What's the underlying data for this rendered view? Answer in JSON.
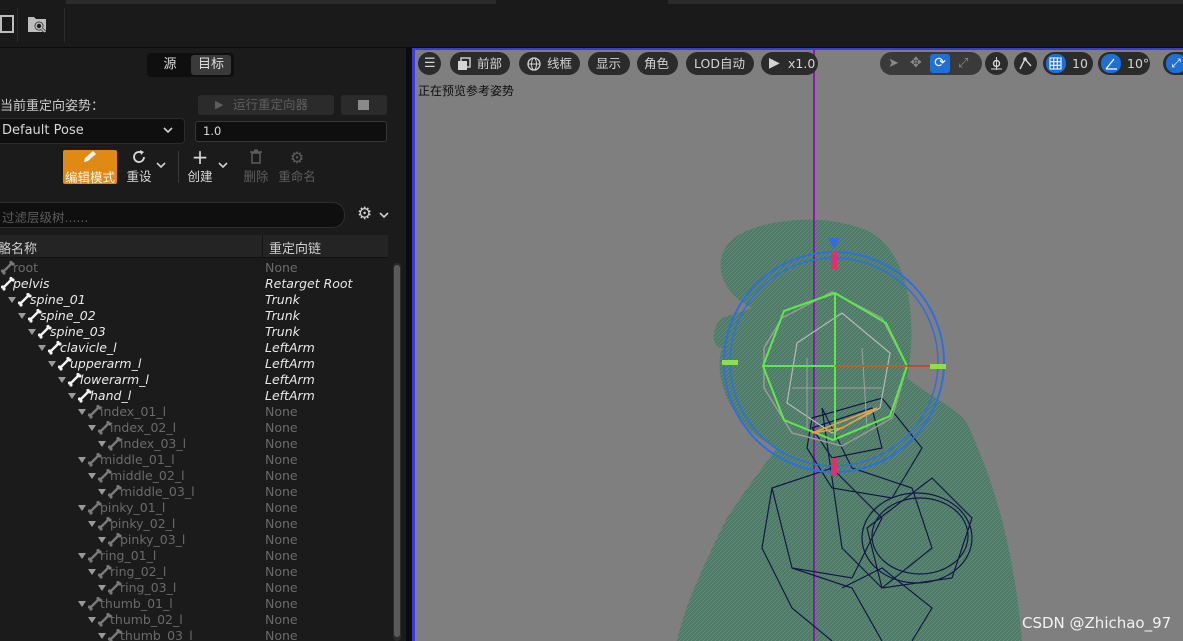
{
  "left_panel": {
    "tabs": [
      "源",
      "目标"
    ],
    "current_pose_label": "当前重定向姿势：",
    "run_retargeter": "运行重定向器",
    "pose_value": "Default Pose",
    "number_value": "1.0",
    "tools": {
      "edit_mode": "编辑模式",
      "reset": "重设",
      "create": "创建",
      "delete": "删除",
      "rename": "重命名"
    },
    "search_placeholder": "过滤层级树......",
    "columns": {
      "name": "骨骼名称",
      "name_visible": "骼名称",
      "chain": "重定向链"
    },
    "rows": [
      {
        "name": "root",
        "chain": "None",
        "indent": 0,
        "dim": true
      },
      {
        "name": "pelvis",
        "chain": "Retarget Root",
        "indent": 0,
        "dim": false
      },
      {
        "name": "spine_01",
        "chain": "Trunk",
        "indent": 1,
        "dim": false
      },
      {
        "name": "spine_02",
        "chain": "Trunk",
        "indent": 2,
        "dim": false
      },
      {
        "name": "spine_03",
        "chain": "Trunk",
        "indent": 3,
        "dim": false
      },
      {
        "name": "clavicle_l",
        "chain": "LeftArm",
        "indent": 4,
        "dim": false
      },
      {
        "name": "upperarm_l",
        "chain": "LeftArm",
        "indent": 5,
        "dim": false
      },
      {
        "name": "lowerarm_l",
        "chain": "LeftArm",
        "indent": 6,
        "dim": false
      },
      {
        "name": "hand_l",
        "chain": "LeftArm",
        "indent": 7,
        "dim": false
      },
      {
        "name": "index_01_l",
        "chain": "None",
        "indent": 8,
        "dim": true
      },
      {
        "name": "index_02_l",
        "chain": "None",
        "indent": 9,
        "dim": true
      },
      {
        "name": "index_03_l",
        "chain": "None",
        "indent": 10,
        "dim": true
      },
      {
        "name": "middle_01_l",
        "chain": "None",
        "indent": 8,
        "dim": true
      },
      {
        "name": "middle_02_l",
        "chain": "None",
        "indent": 9,
        "dim": true
      },
      {
        "name": "middle_03_l",
        "chain": "None",
        "indent": 10,
        "dim": true
      },
      {
        "name": "pinky_01_l",
        "chain": "None",
        "indent": 8,
        "dim": true
      },
      {
        "name": "pinky_02_l",
        "chain": "None",
        "indent": 9,
        "dim": true
      },
      {
        "name": "pinky_03_l",
        "chain": "None",
        "indent": 10,
        "dim": true
      },
      {
        "name": "ring_01_l",
        "chain": "None",
        "indent": 8,
        "dim": true
      },
      {
        "name": "ring_02_l",
        "chain": "None",
        "indent": 9,
        "dim": true
      },
      {
        "name": "ring_03_l",
        "chain": "None",
        "indent": 10,
        "dim": true
      },
      {
        "name": "thumb_01_l",
        "chain": "None",
        "indent": 8,
        "dim": true
      },
      {
        "name": "thumb_02_l",
        "chain": "None",
        "indent": 9,
        "dim": true
      },
      {
        "name": "thumb_03_l",
        "chain": "None",
        "indent": 10,
        "dim": true
      }
    ]
  },
  "viewport": {
    "menu_icon": "hamburger-icon",
    "view_front": "前部",
    "wireframe": "线框",
    "show": "显示",
    "character": "角色",
    "lod": "LOD自动",
    "speed": "x1.0",
    "grid_value": "10",
    "angle_value": "10°",
    "preview_text": "正在预览参考姿势"
  },
  "watermark": "CSDN @Zhichao_97",
  "colors": {
    "edit_accent": "#e08a14",
    "viewport_bg": "#7f7f7f",
    "mesh_green": "#4f7a68",
    "active_blue": "#1e6fd6"
  }
}
